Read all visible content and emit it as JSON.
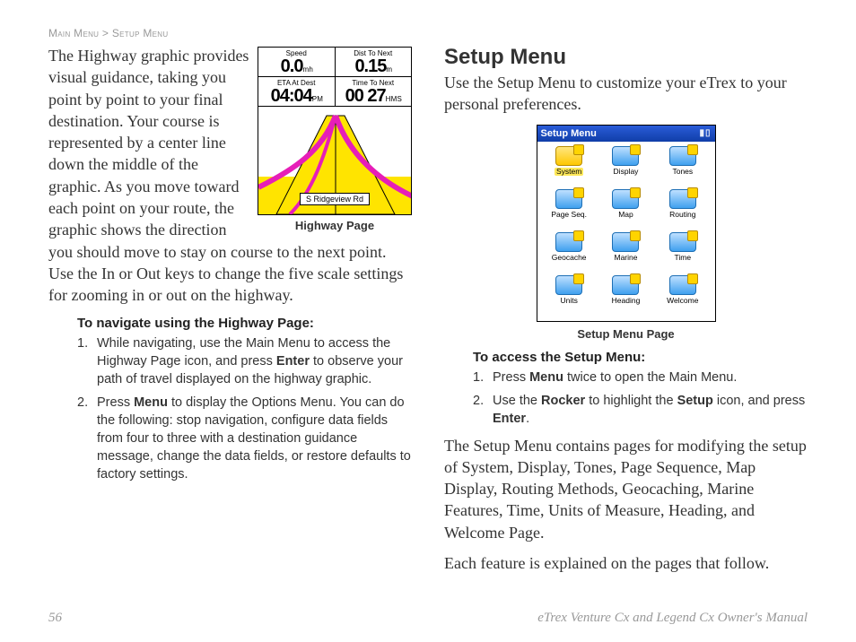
{
  "breadcrumb": {
    "a": "Main Menu",
    "sep": ">",
    "b": "Setup Menu"
  },
  "left": {
    "para": "The Highway graphic provides visual guidance, taking you point by point to your final destination. Your course is represented by a center line down the middle of the graphic. As you move toward each point on your route, the graphic shows the direction you should move to stay on course to the next point. Use the In or Out keys to change the five scale settings for zooming in or out on the highway.",
    "hp": {
      "caption": "Highway Page",
      "cells": {
        "speed_lbl": "Speed",
        "speed_val": "0.0",
        "speed_u": "m h",
        "dist_lbl": "Dist To Next",
        "dist_val": "0.15",
        "dist_u": "m",
        "eta_lbl": "ETA At Dest",
        "eta_val": "04:04",
        "eta_u": "P M",
        "ttn_lbl": "Time To Next",
        "ttn_val": "00 27",
        "ttn_u": "H M S"
      },
      "sign": "S Ridgeview Rd"
    },
    "instr_title": "To navigate using the Highway Page:",
    "steps": [
      "While navigating, use the Main Menu to access the Highway Page icon, and press <b>Enter</b>  to observe your path of travel displayed on the highway graphic.",
      "Press <b>Menu</b> to display the Options Menu. You can do the following: stop navigation, configure data fields from four to three with a destination guidance message, change the data fields, or restore defaults to factory settings."
    ]
  },
  "right": {
    "heading": "Setup Menu",
    "intro": "Use the Setup Menu to customize your eTrex to your personal preferences.",
    "sm": {
      "title": "Setup Menu",
      "caption": "Setup Menu Page",
      "items": [
        "System",
        "Display",
        "Tones",
        "Page Seq.",
        "Map",
        "Routing",
        "Geocache",
        "Marine",
        "Time",
        "Units",
        "Heading",
        "Welcome"
      ],
      "selected": 0
    },
    "instr_title": "To access the Setup Menu:",
    "steps": [
      "Press <b>Menu</b> twice to open the Main Menu.",
      "Use the <b>Rocker</b> to highlight the <b>Setup</b> icon, and press <b>Enter</b>."
    ],
    "para2": "The Setup Menu contains pages for modifying the setup of System, Display, Tones, Page Sequence, Map Display, Routing Methods, Geocaching, Marine Features, Time, Units of Measure, Heading, and Welcome Page.",
    "para3": "Each feature is explained on the pages that follow."
  },
  "footer": {
    "page": "56",
    "title": "eTrex Venture Cx and Legend Cx Owner's Manual"
  }
}
